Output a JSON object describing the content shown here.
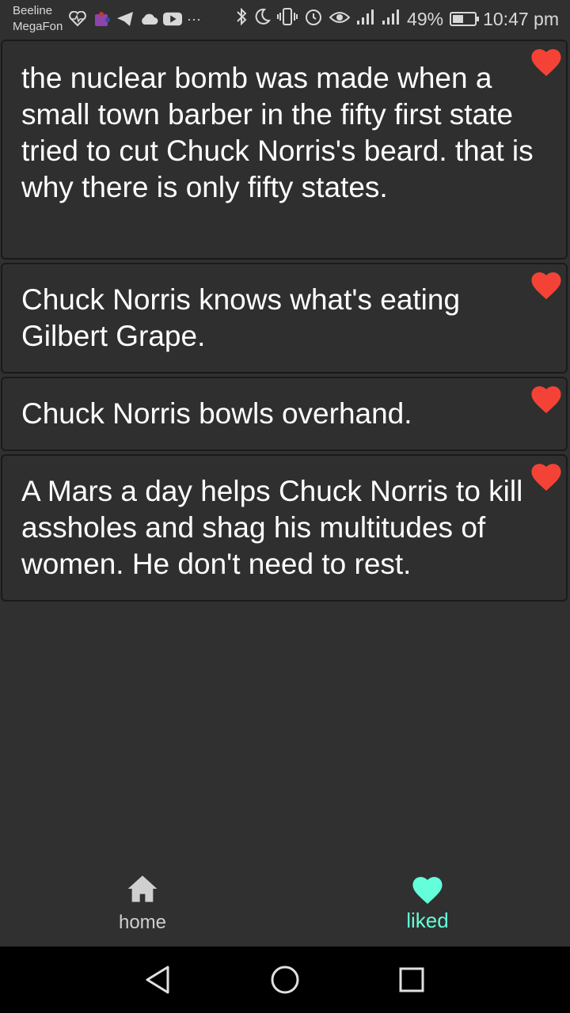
{
  "statusbar": {
    "carrier1": "Beeline",
    "carrier2": "MegaFon",
    "battery_percent": "49%",
    "battery_level": 0.49,
    "time": "10:47 pm",
    "dots": "···",
    "icons": [
      "heart-monitor-icon",
      "puzzle-icon",
      "telegram-icon",
      "cloud-icon",
      "youtube-icon",
      "bluetooth-icon",
      "moon-icon",
      "vibrate-icon",
      "alarm-icon",
      "eye-icon",
      "signal-icon",
      "signal-icon"
    ]
  },
  "jokes": [
    {
      "text": "the nuclear bomb was made when a small town barber in the fifty first state tried to cut Chuck Norris's beard. that is why there is only fifty states.",
      "liked": true
    },
    {
      "text": "Chuck Norris knows what's eating Gilbert Grape.",
      "liked": true
    },
    {
      "text": "Chuck Norris bowls overhand.",
      "liked": true
    },
    {
      "text": "A Mars a day helps Chuck Norris to kill assholes and shag his multitudes of women. He don't need to rest.",
      "liked": true
    }
  ],
  "colors": {
    "heart": "#f44336",
    "active_tab": "#64ffda",
    "inactive_tab": "#cfcfcf",
    "background": "#303030"
  },
  "nav": {
    "home_label": "home",
    "liked_label": "liked",
    "active": "liked"
  }
}
